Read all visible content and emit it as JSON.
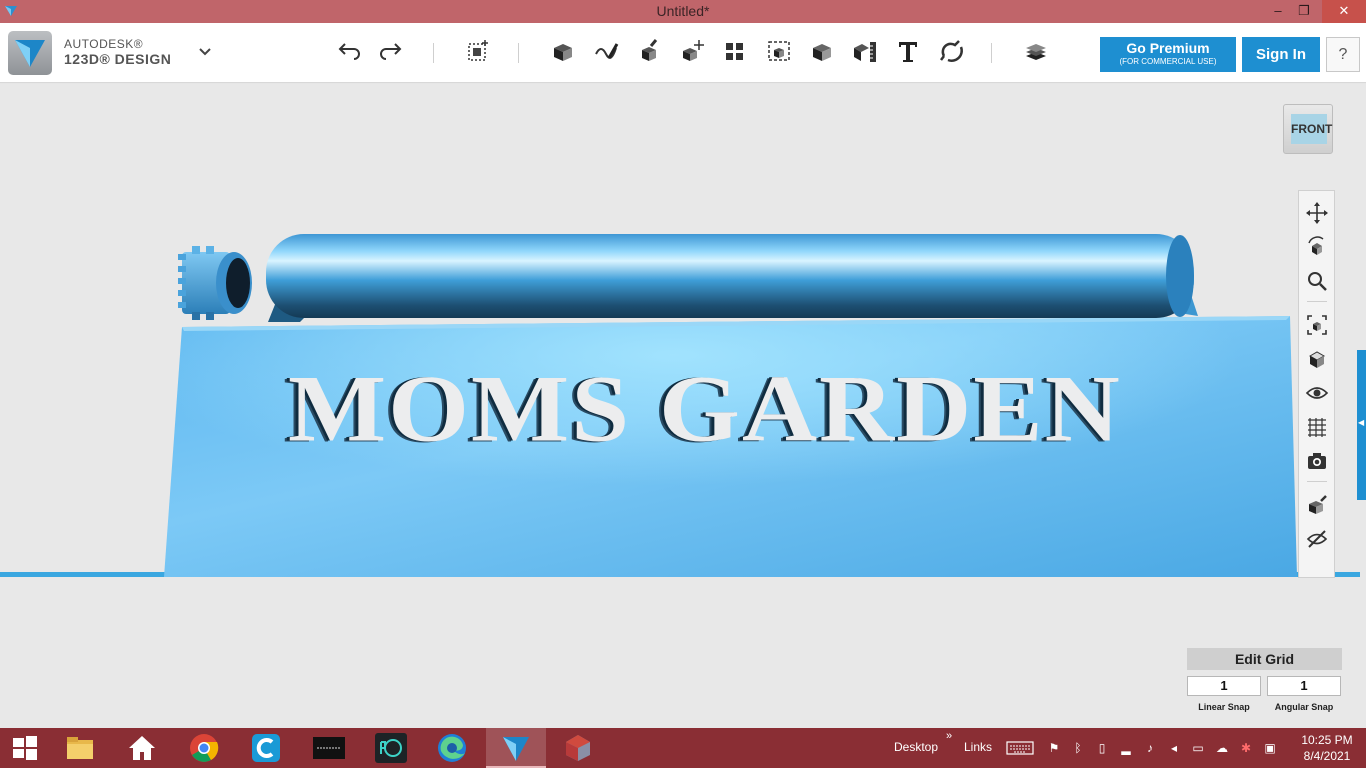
{
  "window": {
    "title": "Untitled*",
    "minimize": "–",
    "restore": "❐",
    "close": "✕"
  },
  "brand": {
    "line1": "AUTODESK®",
    "line2": "123D® DESIGN"
  },
  "toolbar": {
    "tools": [
      "undo-icon",
      "redo-icon",
      "transform-icon",
      "primitives-icon",
      "sketch-icon",
      "construct-icon",
      "modify-icon",
      "pattern-icon",
      "group-icon",
      "combine-icon",
      "measure-icon",
      "text-icon",
      "snap-icon",
      "material-icon"
    ],
    "premium_label": "Go Premium",
    "premium_sub": "(FOR COMMERCIAL USE)",
    "signin_label": "Sign In",
    "help_label": "?"
  },
  "viewport": {
    "model_text": "MOMS GARDEN",
    "view_cube_label": "FRONT",
    "model_color": "#5bb4ec"
  },
  "nav": [
    "pan-icon",
    "orbit-icon",
    "zoom-icon",
    "fit-icon",
    "views-icon",
    "visibility-icon",
    "grid-icon",
    "screenshot-icon",
    "material-icon",
    "hide-icon"
  ],
  "grid": {
    "title": "Edit Grid",
    "linear_value": "1",
    "linear_label": "Linear Snap",
    "angular_value": "1",
    "angular_label": "Angular Snap"
  },
  "taskbar": {
    "desktop_label": "Desktop",
    "links_label": "Links",
    "time": "10:25 PM",
    "date": "8/4/2021",
    "chevron": "»"
  }
}
